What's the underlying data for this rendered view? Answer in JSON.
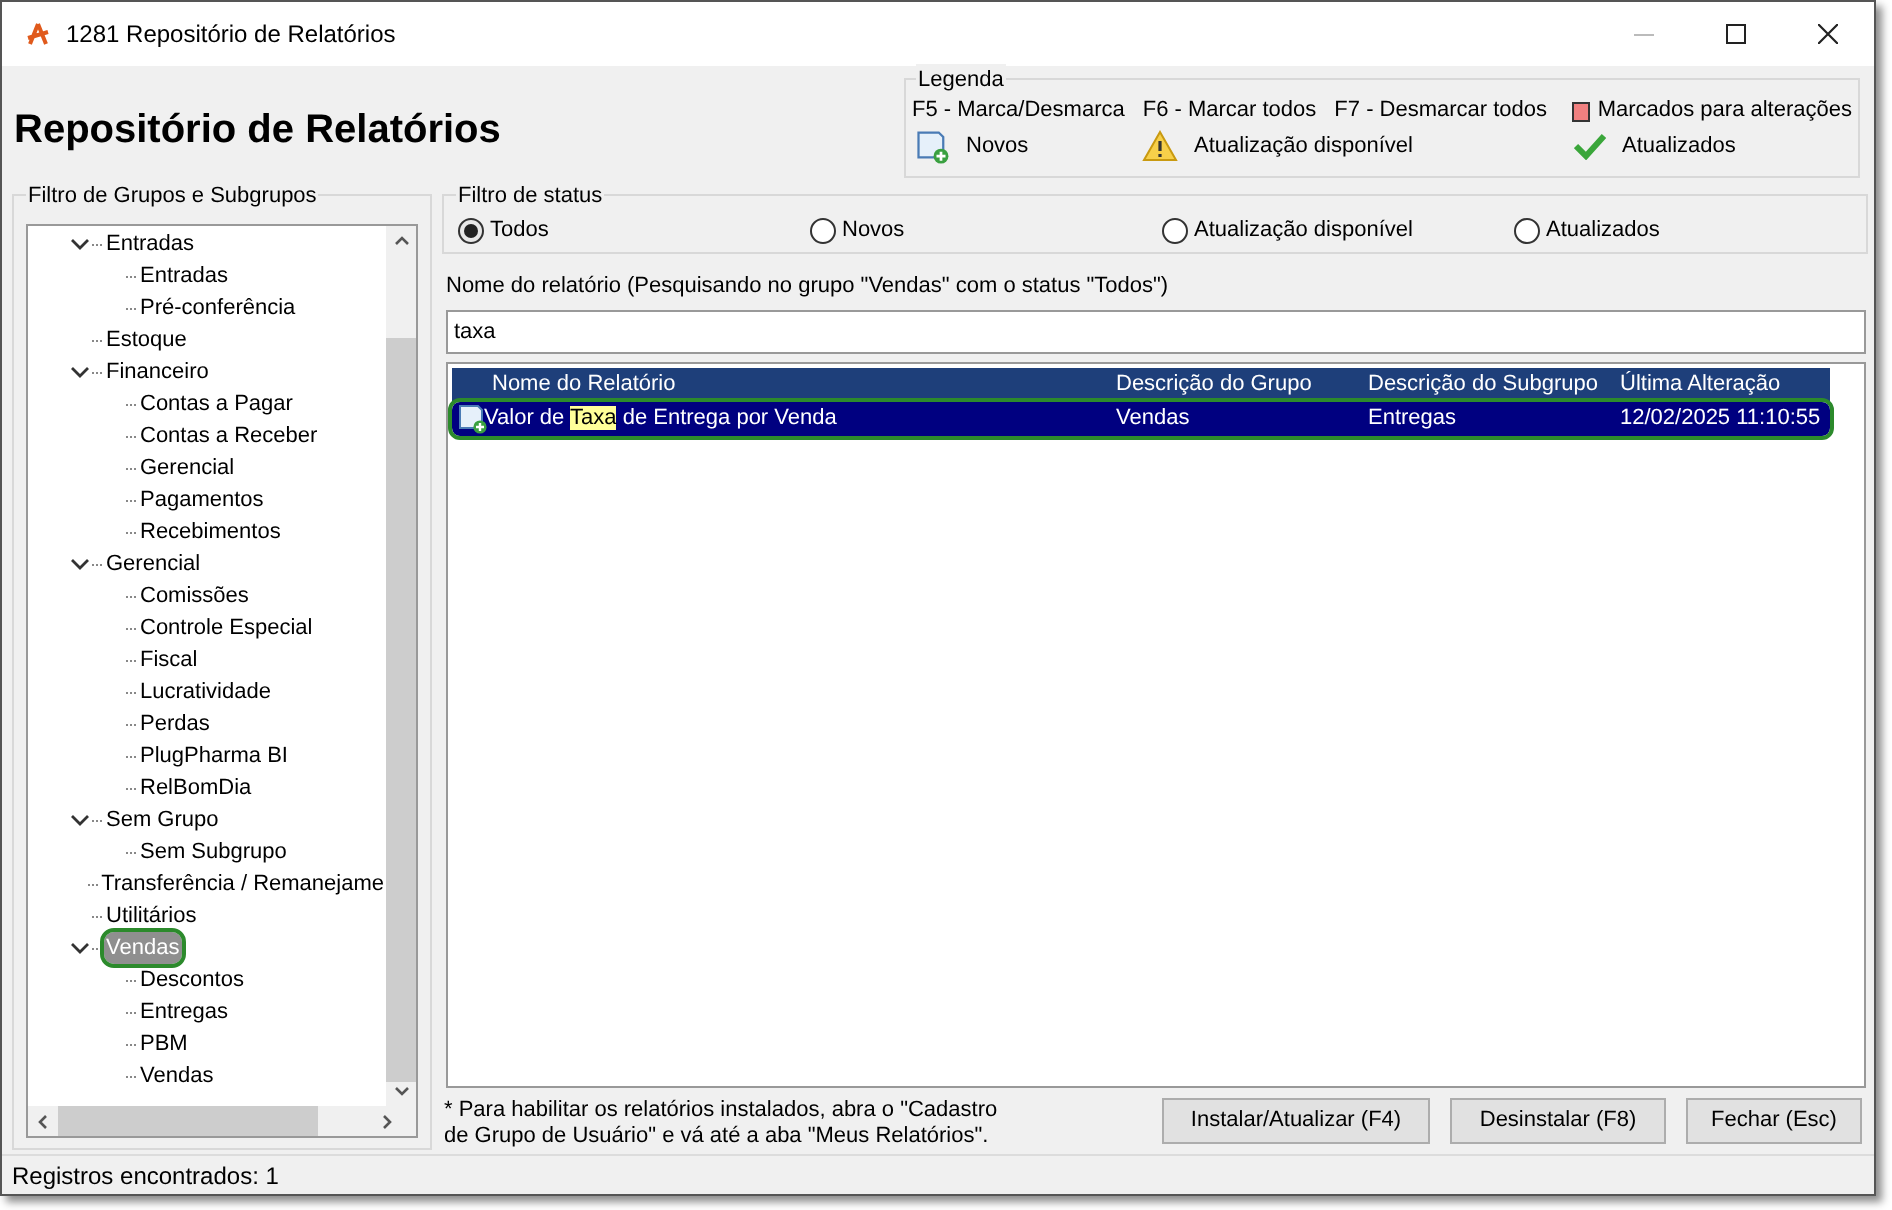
{
  "window": {
    "title": "1281 Repositório de Relatórios"
  },
  "heading": "Repositório de Relatórios",
  "legend": {
    "title": "Legenda",
    "shortcuts": [
      "F5 - Marca/Desmarca",
      "F6 - Marcar todos",
      "F7 - Desmarcar todos"
    ],
    "marked": {
      "label": "Marcados para alterações",
      "color": "#f08080"
    },
    "icons": [
      {
        "kind": "new",
        "label": "Novos"
      },
      {
        "kind": "warning",
        "label": "Atualização disponível"
      },
      {
        "kind": "check",
        "label": "Atualizados"
      }
    ]
  },
  "groups_filter": {
    "title": "Filtro de Grupos e Subgrupos",
    "tree": [
      {
        "label": "Entradas",
        "expanded": true,
        "selected": false,
        "children": [
          {
            "label": "Entradas",
            "selected": false
          },
          {
            "label": "Pré-conferência",
            "selected": false
          }
        ]
      },
      {
        "label": "Estoque",
        "selected": false
      },
      {
        "label": "Financeiro",
        "expanded": true,
        "selected": false,
        "children": [
          {
            "label": "Contas a Pagar",
            "selected": false
          },
          {
            "label": "Contas a Receber",
            "selected": false
          },
          {
            "label": "Gerencial",
            "selected": false
          },
          {
            "label": "Pagamentos",
            "selected": false
          },
          {
            "label": "Recebimentos",
            "selected": false
          }
        ]
      },
      {
        "label": "Gerencial",
        "expanded": true,
        "selected": false,
        "children": [
          {
            "label": "Comissões",
            "selected": false
          },
          {
            "label": "Controle Especial",
            "selected": false
          },
          {
            "label": "Fiscal",
            "selected": false
          },
          {
            "label": "Lucratividade",
            "selected": false
          },
          {
            "label": "Perdas",
            "selected": false
          },
          {
            "label": "PlugPharma BI",
            "selected": false
          },
          {
            "label": "RelBomDia",
            "selected": false
          }
        ]
      },
      {
        "label": "Sem Grupo",
        "expanded": true,
        "selected": false,
        "children": [
          {
            "label": "Sem Subgrupo",
            "selected": false
          }
        ]
      },
      {
        "label": "Transferência / Remanejame",
        "selected": false
      },
      {
        "label": "Utilitários",
        "selected": false
      },
      {
        "label": "Vendas",
        "expanded": true,
        "selected": true,
        "children": [
          {
            "label": "Descontos",
            "selected": false
          },
          {
            "label": "Entregas",
            "selected": false
          },
          {
            "label": "PBM",
            "selected": false
          },
          {
            "label": "Vendas",
            "selected": false
          }
        ]
      }
    ]
  },
  "status_filter": {
    "title": "Filtro de status",
    "options": [
      {
        "label": "Todos",
        "selected": true
      },
      {
        "label": "Novos",
        "selected": false
      },
      {
        "label": "Atualização disponível",
        "selected": false
      },
      {
        "label": "Atualizados",
        "selected": false
      }
    ]
  },
  "search": {
    "label": "Nome do relatório (Pesquisando no grupo \"Vendas\" com o status \"Todos\")",
    "value": "taxa"
  },
  "table": {
    "columns": [
      "Nome do Relatório",
      "Descrição do Grupo",
      "Descrição do Subgrupo",
      "Última Alteração"
    ],
    "rows": [
      {
        "kind": "new",
        "selected": true,
        "name_parts": [
          {
            "text": "Valor de ",
            "match": false
          },
          {
            "text": "Taxa",
            "match": true
          },
          {
            "text": " de Entrega por Venda",
            "match": false
          }
        ],
        "group": "Vendas",
        "subgroup": "Entregas",
        "date": "12/02/2025 11:10:55"
      }
    ]
  },
  "note": "* Para habilitar os relatórios instalados, abra o \"Cadastro de Grupo de Usuário\" e vá até a aba \"Meus Relatórios\".",
  "buttons": [
    "Instalar/Atualizar (F4)",
    "Desinstalar (F8)",
    "Fechar (Esc)"
  ],
  "status_bar": "Registros encontrados: 1"
}
